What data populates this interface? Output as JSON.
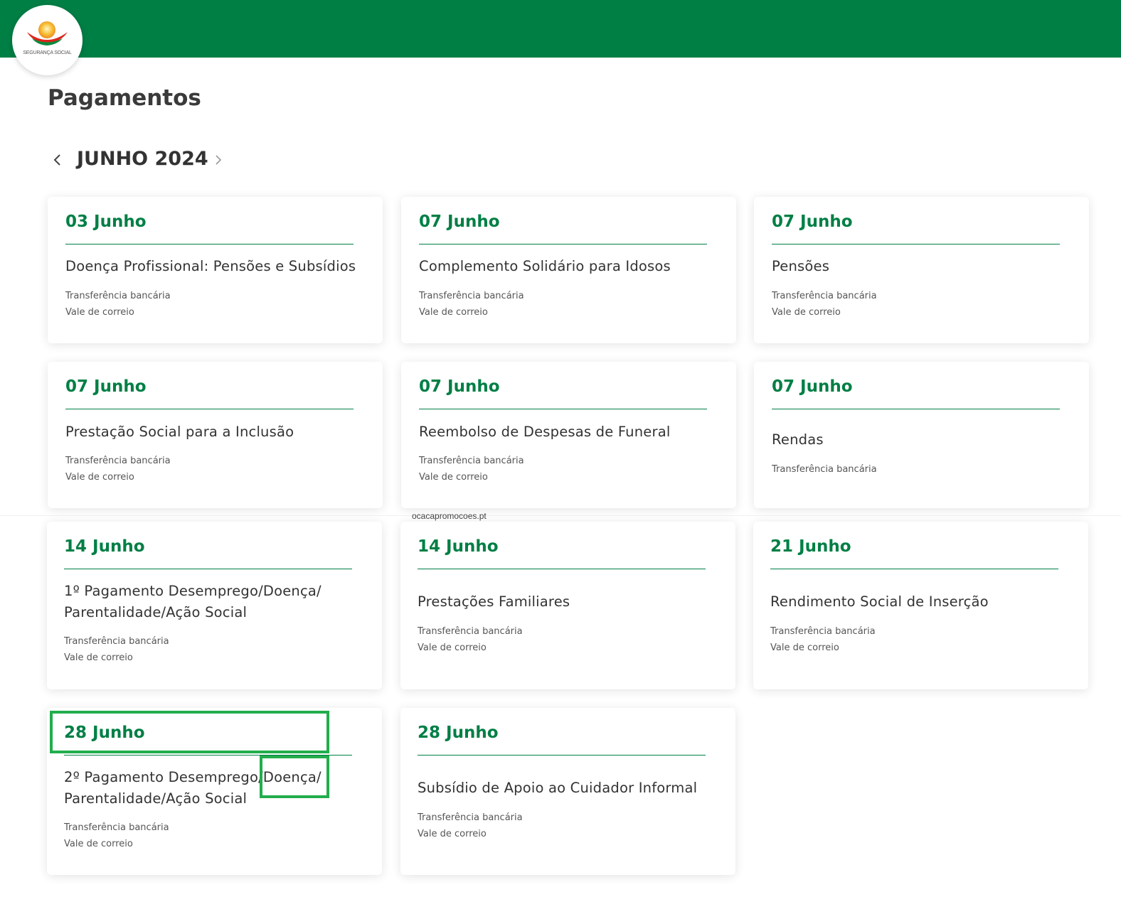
{
  "header": {
    "logo_text": "SEGURANÇA SOCIAL",
    "brand_color": "#007f45"
  },
  "page": {
    "title": "Pagamentos",
    "month": "JUNHO 2024",
    "prev_icon": "chevron-left-icon",
    "next_icon": "chevron-right-icon"
  },
  "cards": [
    {
      "date": "03 Junho",
      "title": "Doença Profissional: Pensões e Subsídios",
      "methods": [
        "Transferência bancária",
        "Vale de correio"
      ]
    },
    {
      "date": "07 Junho",
      "title": "Complemento Solidário para Idosos",
      "methods": [
        "Transferência bancária",
        "Vale de correio"
      ]
    },
    {
      "date": "07 Junho",
      "title": "Pensões",
      "methods": [
        "Transferência bancária",
        "Vale de correio"
      ]
    },
    {
      "date": "07 Junho",
      "title": "Prestação Social para a Inclusão",
      "methods": [
        "Transferência bancária",
        "Vale de correio"
      ]
    },
    {
      "date": "07 Junho",
      "title": "Reembolso de Despesas de Funeral",
      "methods": [
        "Transferência bancária",
        "Vale de correio"
      ]
    },
    {
      "date": "07 Junho",
      "title": "Rendas",
      "methods": [
        "Transferência bancária"
      ]
    },
    {
      "date": "14 Junho",
      "title": "1º Pagamento Desemprego/Doença/ Parentalidade/Ação Social",
      "methods": [
        "Transferência bancária",
        "Vale de correio"
      ]
    },
    {
      "date": "14 Junho",
      "title": "Prestações Familiares",
      "methods": [
        "Transferência bancária",
        "Vale de correio"
      ]
    },
    {
      "date": "21 Junho",
      "title": "Rendimento Social de Inserção",
      "methods": [
        "Transferência bancária",
        "Vale de correio"
      ]
    },
    {
      "date": "28 Junho",
      "title": "2º Pagamento Desemprego/Doença/ Parentalidade/Ação Social",
      "methods": [
        "Transferência bancária",
        "Vale de correio"
      ]
    },
    {
      "date": "28 Junho",
      "title": "Subsídio de Apoio ao Cuidador Informal",
      "methods": [
        "Transferência bancária",
        "Vale de correio"
      ]
    }
  ],
  "watermark": "ocacapromocoes.pt",
  "highlight_color": "#22ad4d"
}
